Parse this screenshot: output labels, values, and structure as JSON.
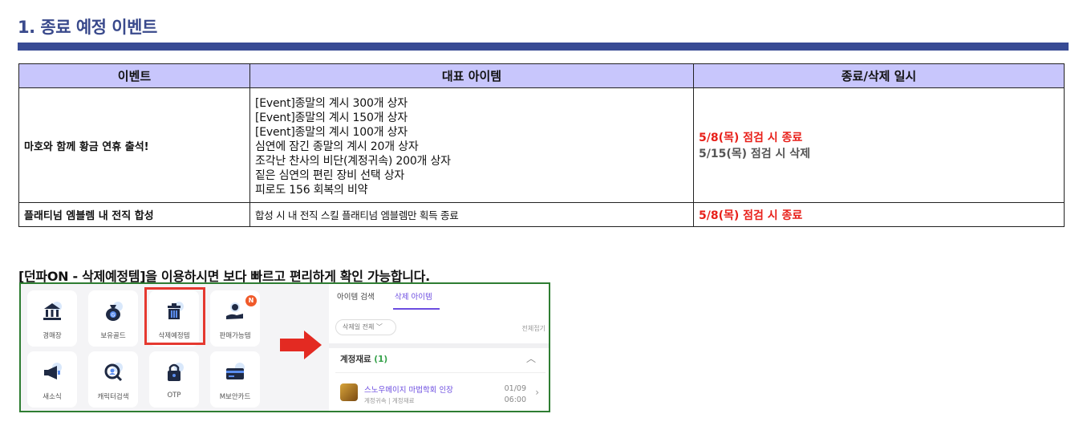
{
  "section_title": "1. 종료 예정 이벤트",
  "table": {
    "headers": [
      "이벤트",
      "대표 아이템",
      "종료/삭제 일시"
    ],
    "rows": [
      {
        "event": "마호와 함께 황금 연휴 출석!",
        "items": [
          "[Event]종말의 계시 300개 상자",
          "[Event]종말의 계시 150개 상자",
          "[Event]종말의 계시 100개 상자",
          "심연에 잠긴 종말의 계시 20개 상자",
          "조각난 찬사의 비단(계정귀속) 200개 상자",
          "짙은 심연의 편린 장비 선택 상자",
          "피로도 156 회복의 비약"
        ],
        "end": "5/8(목) 점검 시 종료",
        "delete": "5/15(목) 점검 시 삭제"
      },
      {
        "event": "플래티넘 엠블렘 내 전직 합성",
        "items_text": "합성 시 내 전직 스킬 플래티넘 엠블렘만 획득 종료",
        "end": "5/8(목) 점검 시 종료"
      }
    ]
  },
  "notice": "[던파ON - 삭제예정템]을 이용하시면 보다 빠르고 편리하게 확인 가능합니다.",
  "app": {
    "tiles": [
      {
        "label": "경매장",
        "icon": "bank-icon"
      },
      {
        "label": "보유골드",
        "icon": "gold-bag-icon"
      },
      {
        "label": "삭제예정템",
        "icon": "trash-icon"
      },
      {
        "label": "판매가능템",
        "icon": "sell-item-icon"
      },
      {
        "label": "새소식",
        "icon": "megaphone-icon"
      },
      {
        "label": "캐릭터검색",
        "icon": "character-search-icon"
      },
      {
        "label": "OTP",
        "icon": "lock-icon"
      },
      {
        "label": "M보안카드",
        "icon": "security-card-icon"
      }
    ],
    "badge": "N",
    "tabs": [
      "아이템 검색",
      "삭제 아이템"
    ],
    "filter": "삭제일 전체",
    "fold": "전체접기",
    "category": "계정재료",
    "category_count": "(1)",
    "item_name": "스노우메이지 마법학회 인장",
    "item_sub": "계정귀속 | 계정재료",
    "item_date": "01/09",
    "item_time": "06:00"
  },
  "colors": {
    "title": "#3a4a8c",
    "header_bg": "#c8c6fc",
    "red": "#e8201a",
    "accent": "#6c4de0"
  }
}
